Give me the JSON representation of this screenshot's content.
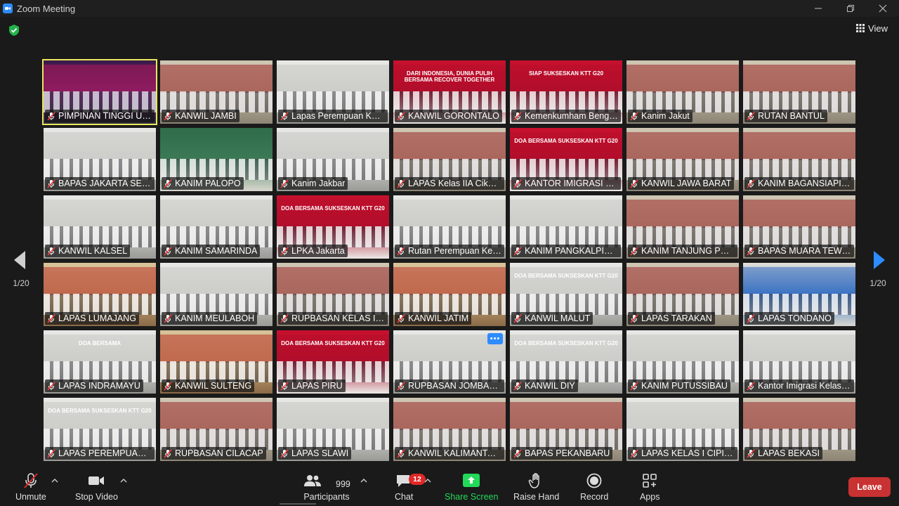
{
  "window": {
    "title": "Zoom Meeting"
  },
  "header": {
    "view_label": "View"
  },
  "pagination": {
    "left_label": "1/20",
    "right_label": "1/20"
  },
  "participants": [
    {
      "name": "PIMPINAN TINGGI UNI...",
      "scene": "stage",
      "active": true
    },
    {
      "name": "KANWIL JAMBI",
      "scene": "hall"
    },
    {
      "name": "Lapas Perempuan Kela...",
      "scene": "white"
    },
    {
      "name": "KANWIL GORONTALO",
      "scene": "red",
      "banner": "DARI INDONESIA, DUNIA PULIH BERSAMA RECOVER TOGETHER"
    },
    {
      "name": "Kemenkumham Bengk...",
      "scene": "red",
      "banner": "SIAP SUKSESKAN KTT G20"
    },
    {
      "name": "Kanim Jakut",
      "scene": "hall"
    },
    {
      "name": "RUTAN BANTUL",
      "scene": "hall"
    },
    {
      "name": "BAPAS JAKARTA SELAT...",
      "scene": "white"
    },
    {
      "name": "KANIM PALOPO",
      "scene": "green"
    },
    {
      "name": "Kanim Jakbar",
      "scene": "white"
    },
    {
      "name": "LAPAS Kelas IIA Cikara...",
      "scene": "hall"
    },
    {
      "name": "KANTOR IMIGRASI KEL...",
      "scene": "red",
      "banner": "DOA BERSAMA SUKSESKAN KTT G20"
    },
    {
      "name": "KANWIL JAWA BARAT",
      "scene": "hall"
    },
    {
      "name": "KANIM BAGANSIAPIAPI",
      "scene": "hall"
    },
    {
      "name": "KANWIL KALSEL",
      "scene": "white"
    },
    {
      "name": "KANIM SAMARINDA",
      "scene": "white"
    },
    {
      "name": "LPKA Jakarta",
      "scene": "red",
      "banner": "DOA BERSAMA SUKSESKAN KTT G20"
    },
    {
      "name": "Rutan Perempuan Kela...",
      "scene": "white"
    },
    {
      "name": "KANIM PANGKALPINA...",
      "scene": "white"
    },
    {
      "name": "KANIM TANJUNG PRIOK",
      "scene": "hall"
    },
    {
      "name": "BAPAS MUARA TEWEH",
      "scene": "hall"
    },
    {
      "name": "LAPAS LUMAJANG",
      "scene": "warm"
    },
    {
      "name": "KANIM MEULABOH",
      "scene": "white"
    },
    {
      "name": "RUPBASAN KELAS I JA...",
      "scene": "hall"
    },
    {
      "name": "KANWIL JATIM",
      "scene": "warm"
    },
    {
      "name": "KANWIL MALUT",
      "scene": "white",
      "banner": "DOA BERSAMA SUKSESKAN KTT G20"
    },
    {
      "name": "LAPAS TARAKAN",
      "scene": "hall"
    },
    {
      "name": "LAPAS TONDANO",
      "scene": "blue"
    },
    {
      "name": "LAPAS INDRAMAYU",
      "scene": "white",
      "banner": "DOA BERSAMA"
    },
    {
      "name": "KANWIL SULTENG",
      "scene": "warm"
    },
    {
      "name": "LAPAS PIRU",
      "scene": "red",
      "banner": "DOA BERSAMA SUKSESKAN KTT G20"
    },
    {
      "name": "RUPBASAN JOMBANG",
      "scene": "white",
      "more": true
    },
    {
      "name": "KANWIL DIY",
      "scene": "white",
      "banner": "DOA BERSAMA SUKSESKAN KTT G20"
    },
    {
      "name": "KANIM PUTUSSIBAU",
      "scene": "white"
    },
    {
      "name": "Kantor Imigrasi Kelas I...",
      "scene": "white"
    },
    {
      "name": "LAPAS PEREMPUAN K...",
      "scene": "white",
      "banner": "DOA BERSAMA SUKSESKAN KTT G20"
    },
    {
      "name": "RUPBASAN CILACAP",
      "scene": "hall"
    },
    {
      "name": "LAPAS SLAWI",
      "scene": "white"
    },
    {
      "name": "KANWIL KALIMANTAN...",
      "scene": "hall"
    },
    {
      "name": "BAPAS PEKANBARU",
      "scene": "hall"
    },
    {
      "name": "LAPAS KELAS I CIPINA...",
      "scene": "white"
    },
    {
      "name": "LAPAS BEKASI",
      "scene": "hall"
    }
  ],
  "more_label": "•••",
  "toolbar": {
    "unmute_label": "Unmute",
    "stop_video_label": "Stop Video",
    "participants_label": "Participants",
    "participants_count": "999",
    "chat_label": "Chat",
    "chat_badge": "12",
    "share_label": "Share Screen",
    "raise_hand_label": "Raise Hand",
    "record_label": "Record",
    "apps_label": "Apps",
    "leave_label": "Leave"
  },
  "colors": {
    "accent": "#2d8cff",
    "share_green": "#23d959",
    "leave_red": "#c93232",
    "active_speaker": "#e8e85a",
    "muted_red": "#e02828"
  },
  "icons": {
    "app": "zoom-camera-icon",
    "security": "shield-check-icon",
    "view": "grid-view-icon",
    "muted_mic": "mic-muted-icon"
  }
}
